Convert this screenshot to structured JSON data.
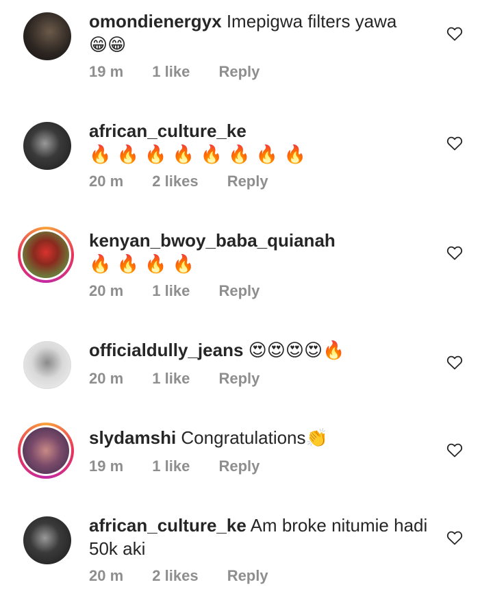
{
  "comments": [
    {
      "username": "omondienergyx",
      "text": "Imepigwa filters yawa",
      "emoji": "😁😁",
      "time": "19 m",
      "likes": "1 like",
      "reply": "Reply",
      "avatar": "dark"
    },
    {
      "username": "african_culture_ke",
      "text": "",
      "emoji": "🔥 🔥 🔥 🔥 🔥 🔥 🔥 🔥",
      "time": "20 m",
      "likes": "2 likes",
      "reply": "Reply",
      "avatar": "dark2"
    },
    {
      "username": "kenyan_bwoy_baba_quianah",
      "text": "",
      "emoji": "🔥 🔥 🔥 🔥",
      "time": "20 m",
      "likes": "1 like",
      "reply": "Reply",
      "avatar": "red-ring"
    },
    {
      "username": "officialdully_jeans",
      "text": "",
      "emoji": "😍😍😍😍🔥",
      "time": "20 m",
      "likes": "1 like",
      "reply": "Reply",
      "avatar": "light"
    },
    {
      "username": "slydamshi",
      "text": "Congratulations",
      "emoji": "👏",
      "time": "19 m",
      "likes": "1 like",
      "reply": "Reply",
      "avatar": "pink-ring"
    },
    {
      "username": "african_culture_ke",
      "text": "Am broke nitumie hadi 50k aki",
      "emoji": "",
      "time": "20 m",
      "likes": "2 likes",
      "reply": "Reply",
      "avatar": "dark2"
    }
  ],
  "icons": {
    "like": "heart-outline-icon"
  }
}
